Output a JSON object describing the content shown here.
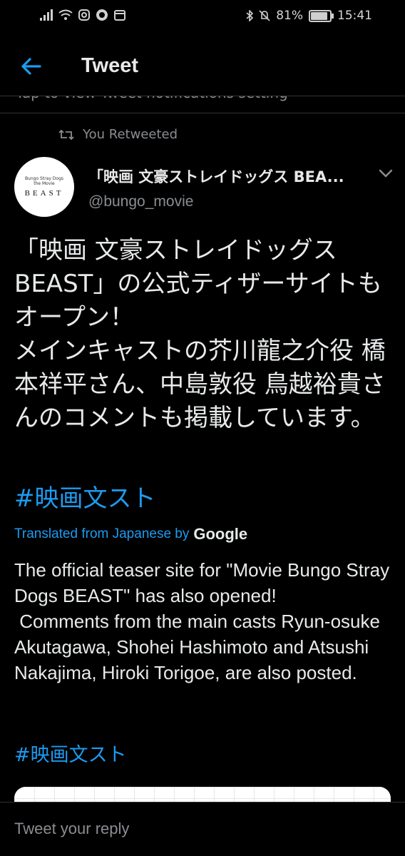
{
  "status_bar": {
    "left_icons": [
      "signal-icon",
      "wifi-icon",
      "instagram-icon",
      "circle-icon",
      "calendar-icon"
    ],
    "right_icons": [
      "bluetooth-icon",
      "mute-icon"
    ],
    "battery": "81%",
    "battery_level": 0.81,
    "time": "15:41"
  },
  "header": {
    "title": "Tweet",
    "accent": "#1d9bf0"
  },
  "notification_strip": {
    "text": "Tap to view Tweet notifications setting"
  },
  "tweet": {
    "retweet_label": "You Retweeted",
    "avatar": {
      "subtitle_1": "Bungo Stray Dogs",
      "subtitle_2": "the Movie",
      "title": "BEAST"
    },
    "author_name": "「映画 文豪ストレイドッグス BEA...",
    "author_handle": "@bungo_movie",
    "text_jp": "「映画 文豪ストレイドッグス BEAST」の公式ティザーサイトもオープン！\nメインキャストの芥川龍之介役 橋本祥平さん、中島敦役 鳥越裕貴さんのコメントも掲載しています。",
    "hashtag": "#映画文スト",
    "translated_label": "Translated from Japanese by",
    "translator": "Google",
    "text_en": "The official teaser site for \"Movie Bungo Stray Dogs BEAST\" has also opened!\n Comments from the main casts Ryun-osuke Akutagawa, Shohei Hashimoto and Atsushi Nakajima, Hiroki Torigoe, are also posted.",
    "hashtag_translated": "#映画文スト"
  },
  "reply": {
    "placeholder": "Tweet your reply"
  }
}
